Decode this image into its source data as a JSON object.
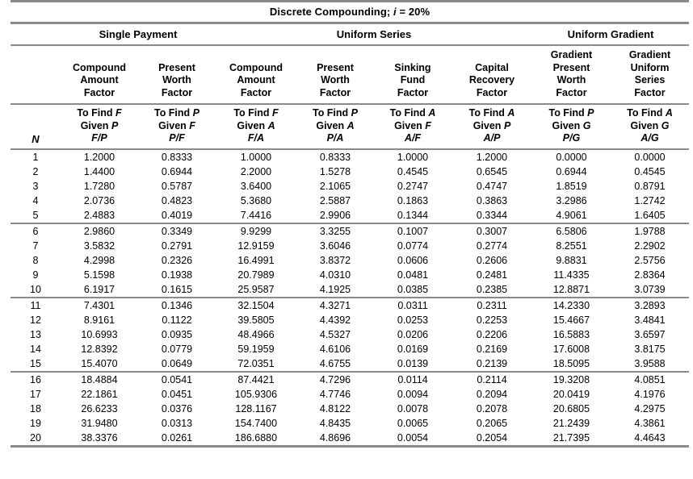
{
  "title": {
    "text_before": "Discrete Compounding;",
    "variable": "i",
    "text_after": "= 20%",
    "full": "Discrete Compounding; i = 20%"
  },
  "groups": [
    {
      "label": "Single Payment",
      "span": 2
    },
    {
      "label": "Uniform Series",
      "span": 4
    },
    {
      "label": "Uniform Gradient",
      "span": 2
    }
  ],
  "columns": [
    {
      "key": "n",
      "factor_name": [],
      "to_find": "",
      "given": "",
      "ratio": "",
      "n_label": "N"
    },
    {
      "key": "f_p",
      "factor_name": [
        "Compound",
        "Amount",
        "Factor"
      ],
      "to_find_prefix": "To Find",
      "to_find_var": "F",
      "given_prefix": "Given",
      "given_var": "P",
      "ratio": "F/P"
    },
    {
      "key": "p_f",
      "factor_name": [
        "Present",
        "Worth",
        "Factor"
      ],
      "to_find_prefix": "To Find",
      "to_find_var": "P",
      "given_prefix": "Given",
      "given_var": "F",
      "ratio": "P/F"
    },
    {
      "key": "f_a",
      "factor_name": [
        "Compound",
        "Amount",
        "Factor"
      ],
      "to_find_prefix": "To Find",
      "to_find_var": "F",
      "given_prefix": "Given",
      "given_var": "A",
      "ratio": "F/A"
    },
    {
      "key": "p_a",
      "factor_name": [
        "Present",
        "Worth",
        "Factor"
      ],
      "to_find_prefix": "To Find",
      "to_find_var": "P",
      "given_prefix": "Given",
      "given_var": "A",
      "ratio": "P/A"
    },
    {
      "key": "a_f",
      "factor_name": [
        "Sinking",
        "Fund",
        "Factor"
      ],
      "to_find_prefix": "To Find",
      "to_find_var": "A",
      "given_prefix": "Given",
      "given_var": "F",
      "ratio": "A/F"
    },
    {
      "key": "a_p",
      "factor_name": [
        "Capital",
        "Recovery",
        "Factor"
      ],
      "to_find_prefix": "To Find",
      "to_find_var": "A",
      "given_prefix": "Given",
      "given_var": "P",
      "ratio": "A/P"
    },
    {
      "key": "p_g",
      "factor_name": [
        "Gradient",
        "Present",
        "Worth",
        "Factor"
      ],
      "to_find_prefix": "To Find",
      "to_find_var": "P",
      "given_prefix": "Given",
      "given_var": "G",
      "ratio": "P/G"
    },
    {
      "key": "a_g",
      "factor_name": [
        "Gradient",
        "Uniform",
        "Series",
        "Factor"
      ],
      "to_find_prefix": "To Find",
      "to_find_var": "A",
      "given_prefix": "Given",
      "given_var": "G",
      "ratio": "A/G"
    }
  ],
  "chart_data": {
    "type": "table",
    "title": "Discrete Compounding; i = 20%",
    "interest_rate": "20%",
    "column_headers": [
      "N",
      "F/P",
      "P/F",
      "F/A",
      "P/A",
      "A/F",
      "A/P",
      "P/G",
      "A/G"
    ],
    "group_headers": [
      "Single Payment",
      "Uniform Series",
      "Uniform Gradient"
    ],
    "rows": [
      [
        "1",
        "1.2000",
        "0.8333",
        "1.0000",
        "0.8333",
        "1.0000",
        "1.2000",
        "0.0000",
        "0.0000"
      ],
      [
        "2",
        "1.4400",
        "0.6944",
        "2.2000",
        "1.5278",
        "0.4545",
        "0.6545",
        "0.6944",
        "0.4545"
      ],
      [
        "3",
        "1.7280",
        "0.5787",
        "3.6400",
        "2.1065",
        "0.2747",
        "0.4747",
        "1.8519",
        "0.8791"
      ],
      [
        "4",
        "2.0736",
        "0.4823",
        "5.3680",
        "2.5887",
        "0.1863",
        "0.3863",
        "3.2986",
        "1.2742"
      ],
      [
        "5",
        "2.4883",
        "0.4019",
        "7.4416",
        "2.9906",
        "0.1344",
        "0.3344",
        "4.9061",
        "1.6405"
      ],
      [
        "6",
        "2.9860",
        "0.3349",
        "9.9299",
        "3.3255",
        "0.1007",
        "0.3007",
        "6.5806",
        "1.9788"
      ],
      [
        "7",
        "3.5832",
        "0.2791",
        "12.9159",
        "3.6046",
        "0.0774",
        "0.2774",
        "8.2551",
        "2.2902"
      ],
      [
        "8",
        "4.2998",
        "0.2326",
        "16.4991",
        "3.8372",
        "0.0606",
        "0.2606",
        "9.8831",
        "2.5756"
      ],
      [
        "9",
        "5.1598",
        "0.1938",
        "20.7989",
        "4.0310",
        "0.0481",
        "0.2481",
        "11.4335",
        "2.8364"
      ],
      [
        "10",
        "6.1917",
        "0.1615",
        "25.9587",
        "4.1925",
        "0.0385",
        "0.2385",
        "12.8871",
        "3.0739"
      ],
      [
        "11",
        "7.4301",
        "0.1346",
        "32.1504",
        "4.3271",
        "0.0311",
        "0.2311",
        "14.2330",
        "3.2893"
      ],
      [
        "12",
        "8.9161",
        "0.1122",
        "39.5805",
        "4.4392",
        "0.0253",
        "0.2253",
        "15.4667",
        "3.4841"
      ],
      [
        "13",
        "10.6993",
        "0.0935",
        "48.4966",
        "4.5327",
        "0.0206",
        "0.2206",
        "16.5883",
        "3.6597"
      ],
      [
        "14",
        "12.8392",
        "0.0779",
        "59.1959",
        "4.6106",
        "0.0169",
        "0.2169",
        "17.6008",
        "3.8175"
      ],
      [
        "15",
        "15.4070",
        "0.0649",
        "72.0351",
        "4.6755",
        "0.0139",
        "0.2139",
        "18.5095",
        "3.9588"
      ],
      [
        "16",
        "18.4884",
        "0.0541",
        "87.4421",
        "4.7296",
        "0.0114",
        "0.2114",
        "19.3208",
        "4.0851"
      ],
      [
        "17",
        "22.1861",
        "0.0451",
        "105.9306",
        "4.7746",
        "0.0094",
        "0.2094",
        "20.0419",
        "4.1976"
      ],
      [
        "18",
        "26.6233",
        "0.0376",
        "128.1167",
        "4.8122",
        "0.0078",
        "0.2078",
        "20.6805",
        "4.2975"
      ],
      [
        "19",
        "31.9480",
        "0.0313",
        "154.7400",
        "4.8435",
        "0.0065",
        "0.2065",
        "21.2439",
        "4.3861"
      ],
      [
        "20",
        "38.3376",
        "0.0261",
        "186.6880",
        "4.8696",
        "0.0054",
        "0.2054",
        "21.7395",
        "4.4643"
      ]
    ],
    "group_separator_after_rows": [
      5,
      10,
      15
    ]
  },
  "colors": {
    "rule": "#8a8a8a",
    "text": "#000000",
    "background": "#ffffff"
  }
}
